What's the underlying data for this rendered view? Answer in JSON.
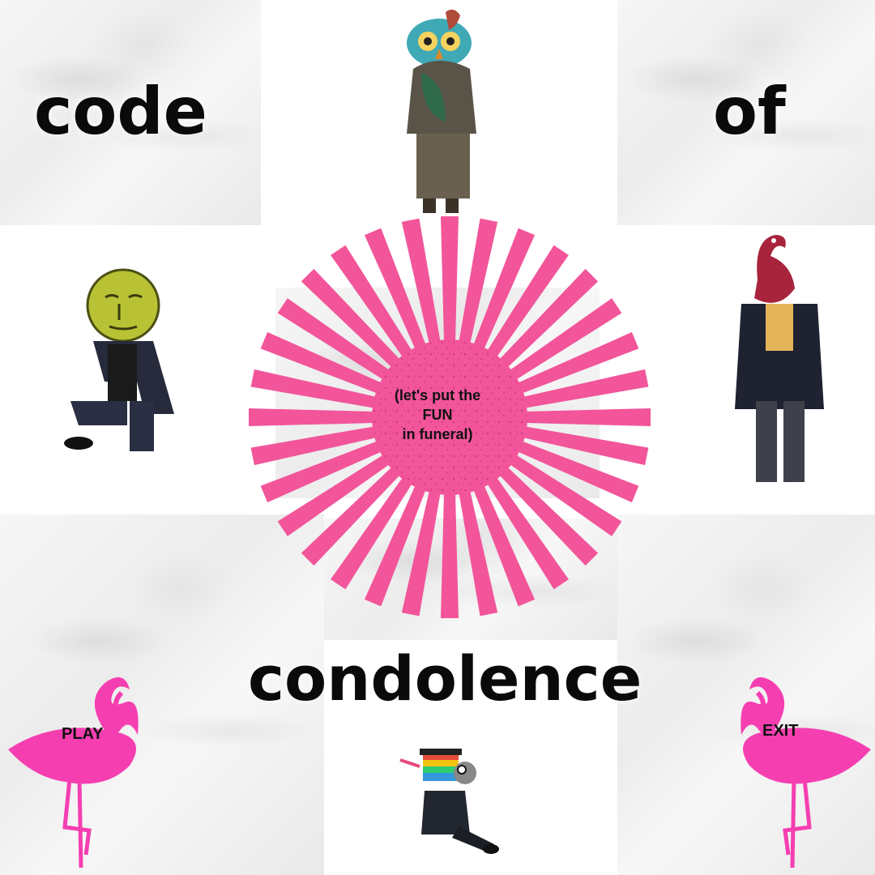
{
  "title": {
    "word1": "code",
    "word2": "of",
    "word3": "condolence"
  },
  "tagline": {
    "line1": "(let's put the",
    "line2": "FUN",
    "line3": "in funeral)"
  },
  "buttons": {
    "play_label": "PLAY",
    "exit_label": "EXIT"
  },
  "colors": {
    "accent_pink": "#f2559a",
    "speckle": "#b01f6a",
    "text": "#0a0a0a"
  },
  "characters": [
    {
      "name": "owl-head-figure",
      "icon": "owl-mask"
    },
    {
      "name": "moon-head-figure",
      "icon": "moon-face-mask"
    },
    {
      "name": "flamingo-head-figure",
      "icon": "flamingo-mask"
    },
    {
      "name": "graduate-head-figure",
      "icon": "rainbow-graduate-mask"
    }
  ]
}
